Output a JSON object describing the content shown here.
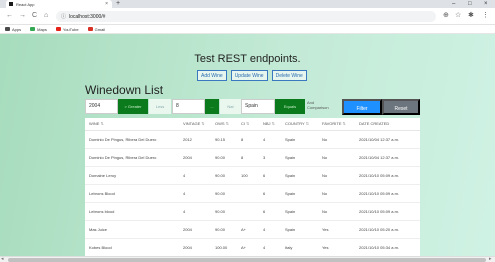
{
  "browser": {
    "tab_title": "React App",
    "tab_close": "×",
    "new_tab": "+",
    "url": "localhost:3000/#",
    "win_min": "–",
    "win_max": "□",
    "win_close": "×",
    "back": "←",
    "forward": "→",
    "reload": "C",
    "home": "⌂",
    "lock": "ⓘ",
    "zoom_icon": "⊕",
    "star_icon": "☆",
    "ext_icon": "✱",
    "menu_icon": "⋮",
    "bookmarks": [
      {
        "label": "Apps",
        "icon": "apps-icon",
        "color": "#4a4a4a"
      },
      {
        "label": "Maps",
        "icon": "maps-icon",
        "color": "#34a853"
      },
      {
        "label": "YouTube",
        "icon": "youtube-icon",
        "color": "#e62117"
      },
      {
        "label": "Gmail",
        "icon": "gmail-icon",
        "color": "#d93025"
      }
    ]
  },
  "page": {
    "title": "Test REST endpoints.",
    "buttons": {
      "add": "Add Wine",
      "update": "Update Wine",
      "delete": "Delete Wine"
    },
    "heading": "Winedown List",
    "filters": {
      "vintage_value": "2004",
      "vintage_op": "> Greater",
      "less_label": "Less",
      "score_value": "8",
      "dots_label": "...",
      "country_placeholder": "Nat",
      "country_value": "Spain",
      "match_label": "Equals",
      "and_label": "And",
      "comparison_label": "Comparison",
      "filter_btn": "Filter",
      "reset_btn": "Reset"
    },
    "table": {
      "columns": [
        "WINE",
        "VINTAGE",
        "OWS",
        "CI",
        "NBJ",
        "COUNTRY",
        "FAVORITE",
        "DATE CREATED"
      ],
      "rows": [
        [
          "Dominio De Pingus, Ribera Del Duero",
          "2012",
          "90.15",
          "8",
          "4",
          "Spain",
          "No",
          "2021/10/04 12:37 a.m."
        ],
        [
          "Dominio De Pingus, Ribera Del Duero",
          "2004",
          "90.00",
          "8",
          "3",
          "Spain",
          "No",
          "2021/10/04 12:37 a.m."
        ],
        [
          "Domaine Leroy",
          "4",
          "90.00",
          "100",
          "6",
          "Spain",
          "No",
          "2021/10/10 05:09 a.m."
        ],
        [
          "Lebrons Blood",
          "4",
          "90.00",
          "",
          "6",
          "Spain",
          "No",
          "2021/10/10 05:09 a.m."
        ],
        [
          "Lebrons blood",
          "4",
          "90.00",
          "",
          "6",
          "Spain",
          "No",
          "2021/10/10 05:09 a.m."
        ],
        [
          "Mas Juice",
          "2004",
          "90.00",
          "A+",
          "4",
          "Spain",
          "Yes",
          "2021/10/10 05:20 a.m."
        ],
        [
          "Kobes Blood",
          "2004",
          "100.00",
          "A+",
          "4",
          "Italy",
          "Yes",
          "2021/10/10 05:34 a.m."
        ]
      ]
    }
  },
  "colors": {
    "accent_blue": "#1e90ff",
    "green_btn": "#0b7a1c",
    "reset_gray": "#6c757d",
    "page_bg": "#b9e6cd"
  }
}
